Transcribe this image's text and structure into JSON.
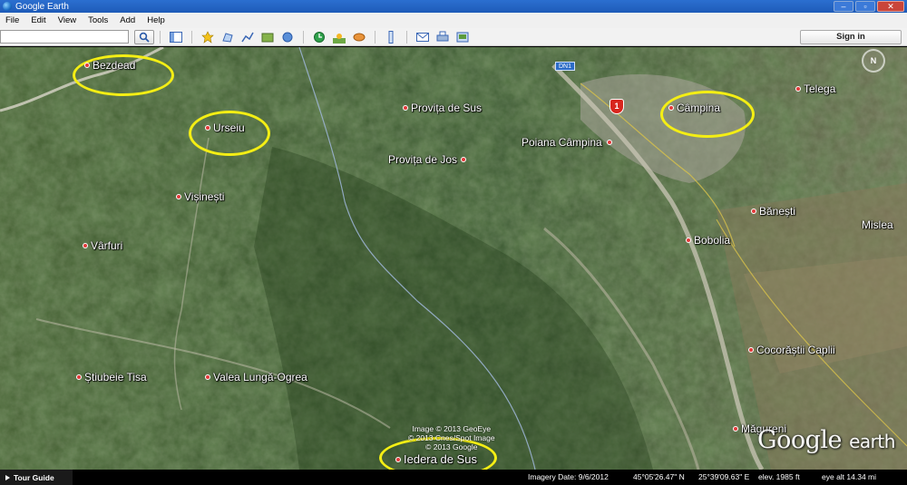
{
  "window": {
    "title": "Google Earth"
  },
  "menu": [
    "File",
    "Edit",
    "View",
    "Tools",
    "Add",
    "Help"
  ],
  "toolbar": {
    "search_value": "",
    "sign_in_label": "Sign in"
  },
  "map": {
    "places": [
      {
        "id": "bezdead",
        "label": "Bezdead",
        "circled": true
      },
      {
        "id": "urseiu",
        "label": "Urseiu",
        "circled": true
      },
      {
        "id": "provita-de-sus",
        "label": "Provița de Sus",
        "circled": false
      },
      {
        "id": "poiana-campina",
        "label": "Poiana Câmpina",
        "circled": false,
        "dot_after": true
      },
      {
        "id": "provita-de-jos",
        "label": "Provița de Jos",
        "circled": false,
        "dot_after": true
      },
      {
        "id": "campina",
        "label": "Câmpina",
        "circled": true
      },
      {
        "id": "telega",
        "label": "Telega",
        "circled": false
      },
      {
        "id": "visinesti",
        "label": "Vișinești",
        "circled": false
      },
      {
        "id": "banesti",
        "label": "Bănești",
        "circled": false
      },
      {
        "id": "mislea",
        "label": "Mislea",
        "circled": false,
        "no_dot": true
      },
      {
        "id": "varfuri",
        "label": "Vârfuri",
        "circled": false
      },
      {
        "id": "bobolia",
        "label": "Bobolia",
        "circled": false
      },
      {
        "id": "cocorastii-caplii",
        "label": "Cocorăștii Caplii",
        "circled": false
      },
      {
        "id": "stubeie-tisa",
        "label": "Știubeie Tisa",
        "circled": false
      },
      {
        "id": "valea-lunga-ogrea",
        "label": "Valea Lungă-Ogrea",
        "circled": false
      },
      {
        "id": "magureni",
        "label": "Măgureni",
        "circled": false
      },
      {
        "id": "iedera-de-sus",
        "label": "Iedera de Sus",
        "circled": true
      }
    ],
    "route_shield": "1",
    "road_badge": "DN1",
    "copyright": [
      "Image © 2013 GeoEye",
      "© 2013 Cnes/Spot Image",
      "© 2013 Google"
    ],
    "logo_google": "Google",
    "logo_earth": "earth",
    "compass_label": "N",
    "colors": {
      "highlight_ring": "#f4ee14",
      "place_dot": "#e23a3a"
    }
  },
  "status": {
    "tour_label": "Tour Guide",
    "imagery_date": "Imagery Date: 9/6/2012",
    "lat": "45°05'26.47\" N",
    "lon": "25°39'09.63\" E",
    "elev": "elev. 1985 ft",
    "eye_alt": "eye alt 14.34 mi"
  }
}
